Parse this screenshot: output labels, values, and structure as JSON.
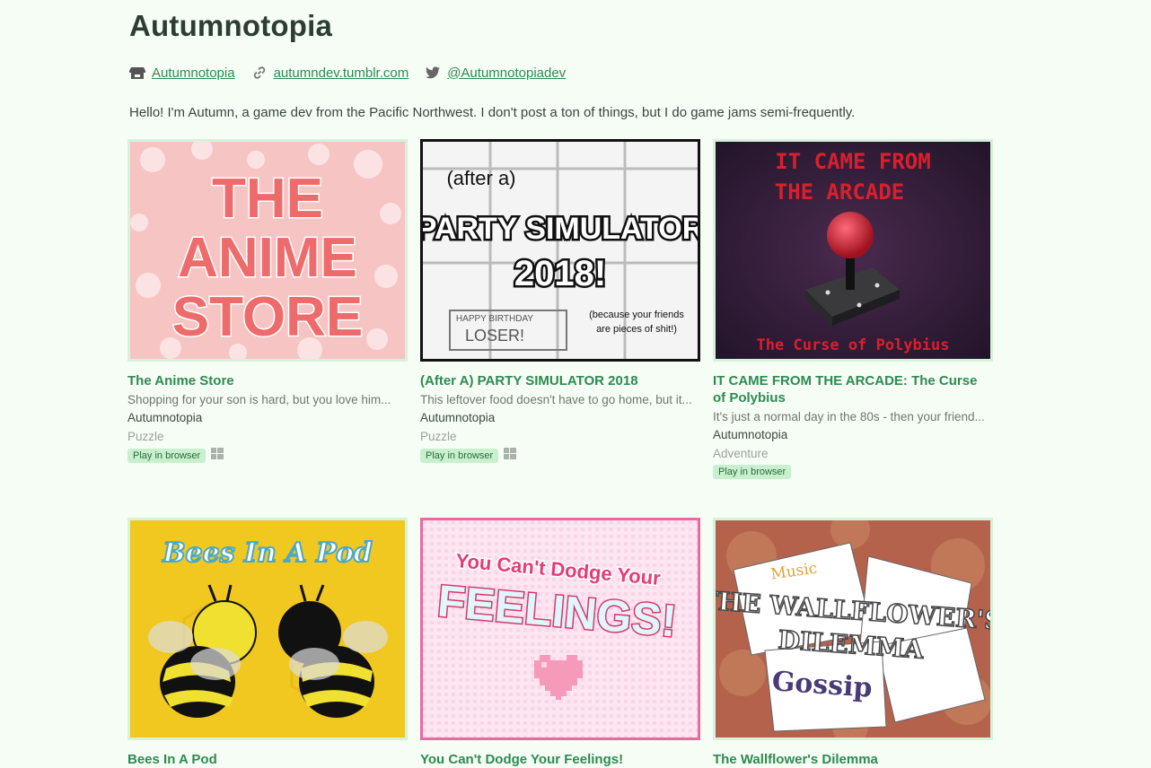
{
  "profile": {
    "title": "Autumnotopia",
    "links": [
      {
        "icon": "itchio-icon",
        "label": "Autumnotopia"
      },
      {
        "icon": "link-icon",
        "label": "autumndev.tumblr.com"
      },
      {
        "icon": "twitter-icon",
        "label": "@Autumnotopiadev"
      }
    ],
    "bio": "Hello! I'm Autumn, a game dev from the Pacific Northwest. I don't post a ton of things, but I do game jams semi-frequently."
  },
  "games": [
    {
      "title": "The Anime Store",
      "desc": "Shopping for your son is hard, but you love him...",
      "author": "Autumnotopia",
      "genre": "Puzzle",
      "badge": "Play in browser",
      "windows": true,
      "art": [
        "THE",
        "ANIME",
        "STORE"
      ]
    },
    {
      "title": "(After A) PARTY SIMULATOR 2018",
      "desc": "This leftover food doesn't have to go home, but it...",
      "author": "Autumnotopia",
      "genre": "Puzzle",
      "badge": "Play in browser",
      "windows": true,
      "art": [
        "(after a)",
        "PARTY SIMULATOR",
        "2018!",
        "HAPPY BIRTHDAY",
        "LOSER!",
        "(because your friends",
        "are pieces of shit!)"
      ]
    },
    {
      "title": "IT CAME FROM THE ARCADE: The Curse of Polybius",
      "desc": "It's just a normal day in the 80s - then your friend...",
      "author": "Autumnotopia",
      "genre": "Adventure",
      "badge": "Play in browser",
      "windows": false,
      "art": [
        "IT CAME FROM",
        "THE ARCADE",
        "The Curse of Polybius"
      ]
    },
    {
      "title": "Bees In A Pod",
      "art": [
        "Bees In A Pod"
      ]
    },
    {
      "title": "You Can't Dodge Your Feelings!",
      "art": [
        "You Can't Dodge Your",
        "FEELINGS!"
      ]
    },
    {
      "title": "The Wallflower's Dilemma",
      "art": [
        "Music",
        "THE WALLFLOWER'S",
        "DILEMMA",
        "Gossip"
      ]
    }
  ],
  "colors": {
    "accent": "#2e8a52",
    "background": "#f5fdf5",
    "badge": "#c8f0cf"
  }
}
